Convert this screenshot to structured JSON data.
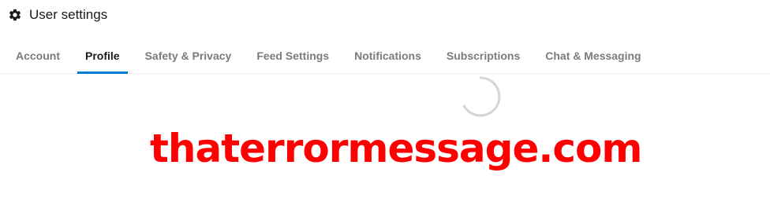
{
  "header": {
    "icon": "gear-icon",
    "title": "User settings"
  },
  "tabs": [
    {
      "label": "Account",
      "active": false
    },
    {
      "label": "Profile",
      "active": true
    },
    {
      "label": "Safety & Privacy",
      "active": false
    },
    {
      "label": "Feed Settings",
      "active": false
    },
    {
      "label": "Notifications",
      "active": false
    },
    {
      "label": "Subscriptions",
      "active": false
    },
    {
      "label": "Chat & Messaging",
      "active": false
    }
  ],
  "loading": {
    "icon": "loading-spinner-icon"
  },
  "watermark": {
    "text": "thaterrormessage.com"
  },
  "colors": {
    "accent": "#0079d3",
    "watermark": "#ff0000",
    "tab_inactive": "#787c7e"
  }
}
